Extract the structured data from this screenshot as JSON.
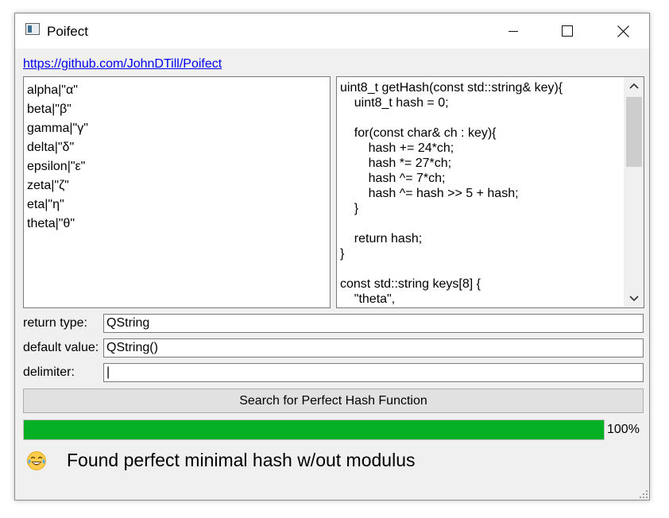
{
  "window": {
    "title": "Poifect"
  },
  "link": {
    "text": "https://github.com/JohnDTill/Poifect"
  },
  "keys_editor": {
    "lines": [
      "alpha|\"α\"",
      "beta|\"β\"",
      "gamma|\"γ\"",
      "delta|\"δ\"",
      "epsilon|\"ε\"",
      "zeta|\"ζ\"",
      "eta|\"η\"",
      "theta|\"θ\""
    ]
  },
  "code_output": {
    "lines": [
      "uint8_t getHash(const std::string& key){",
      "    uint8_t hash = 0;",
      "",
      "    for(const char& ch : key){",
      "        hash += 24*ch;",
      "        hash *= 27*ch;",
      "        hash ^= 7*ch;",
      "        hash ^= hash >> 5 + hash;",
      "    }",
      "",
      "    return hash;",
      "}",
      "",
      "const std::string keys[8] {",
      "    \"theta\","
    ]
  },
  "form": {
    "return_type": {
      "label": "return type:",
      "value": "QString"
    },
    "default_value": {
      "label": "default value:",
      "value": "QString()"
    },
    "delimiter": {
      "label": "delimiter:",
      "value": "|"
    }
  },
  "search_button": {
    "label": "Search for Perfect Hash Function"
  },
  "progress": {
    "percent": 100,
    "label": "100%"
  },
  "status": {
    "emoji": "tears-of-joy-emoji",
    "text": "Found perfect minimal hash w/out modulus"
  },
  "colors": {
    "progress_fill": "#06b025",
    "link": "#0000ee",
    "emoji_face": "#ffcc4d"
  }
}
